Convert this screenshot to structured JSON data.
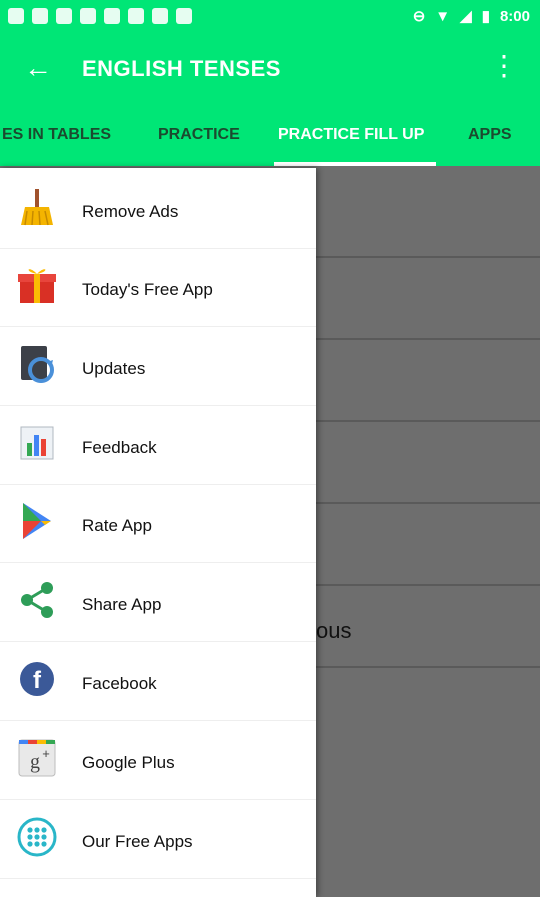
{
  "status_bar": {
    "time": "8:00"
  },
  "app_bar": {
    "title": "ENGLISH TENSES"
  },
  "tabs": [
    {
      "label": "ES IN TABLES"
    },
    {
      "label": "PRACTICE"
    },
    {
      "label": "PRACTICE FILL UP"
    },
    {
      "label": "APPS"
    }
  ],
  "content": {
    "partial_text": "ous"
  },
  "drawer": {
    "items": [
      {
        "label": "Remove Ads",
        "icon": "broom-icon"
      },
      {
        "label": "Today's Free App",
        "icon": "gift-icon"
      },
      {
        "label": "Updates",
        "icon": "update-icon"
      },
      {
        "label": "Feedback",
        "icon": "feedback-chart-icon"
      },
      {
        "label": "Rate App",
        "icon": "play-store-icon"
      },
      {
        "label": "Share App",
        "icon": "share-icon"
      },
      {
        "label": "Facebook",
        "icon": "facebook-icon"
      },
      {
        "label": "Google Plus",
        "icon": "google-plus-icon"
      },
      {
        "label": "Our Free Apps",
        "icon": "apps-grid-icon"
      }
    ]
  },
  "colors": {
    "accent": "#00e676",
    "drawer_bg": "#ffffff",
    "scrim": "#6e6e6e"
  }
}
